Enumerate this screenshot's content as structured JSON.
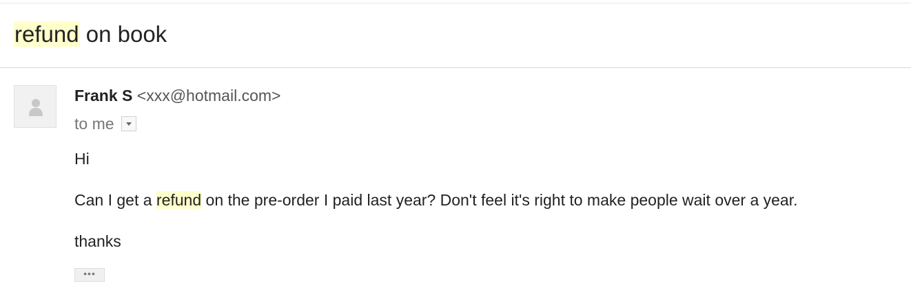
{
  "subject": {
    "highlight": "refund",
    "rest": " on book"
  },
  "message": {
    "sender_name": "Frank S",
    "sender_email": "<xxx@hotmail.com>",
    "recipient": "to me",
    "body": {
      "greeting": "Hi",
      "line_before": "Can I get a ",
      "line_highlight": "refund",
      "line_after": " on the pre-order I paid last year? Don't feel it's right to make people wait over a year.",
      "signoff": "thanks"
    },
    "trimmed_content_label": "•••"
  },
  "icons": {
    "avatar": "person-icon",
    "recipient_details": "chevron-down-icon",
    "show_trimmed": "ellipsis-icon"
  },
  "colors": {
    "search_highlight": "#ffffcc",
    "text": "#222222",
    "muted_text": "#777777"
  }
}
